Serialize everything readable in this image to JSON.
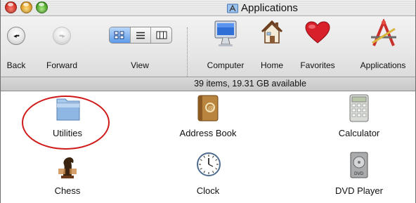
{
  "window": {
    "title": "Applications"
  },
  "toolbar": {
    "back_label": "Back",
    "forward_label": "Forward",
    "view_label": "View",
    "computer_label": "Computer",
    "home_label": "Home",
    "favorites_label": "Favorites",
    "applications_label": "Applications"
  },
  "status": {
    "text": "39 items, 19.31 GB available"
  },
  "files": [
    {
      "label": "Utilities",
      "icon": "folder-icon"
    },
    {
      "label": "Address Book",
      "icon": "address-book-icon"
    },
    {
      "label": "Calculator",
      "icon": "calculator-icon"
    },
    {
      "label": "Chess",
      "icon": "chess-icon"
    },
    {
      "label": "Clock",
      "icon": "clock-icon"
    },
    {
      "label": "DVD Player",
      "icon": "dvd-player-icon"
    }
  ],
  "colors": {
    "annotation": "#d01a1a",
    "selected_segment": "#5d9ae8"
  }
}
